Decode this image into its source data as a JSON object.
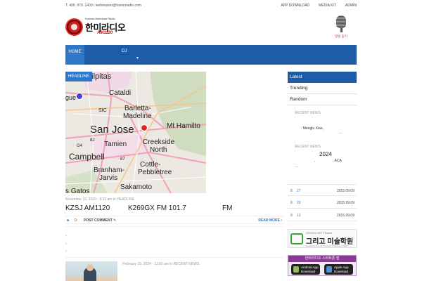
{
  "topbar": {
    "contact": "T: 408. 970. 1400 / webmaster@hanmiradio.com",
    "links": [
      "APP DOWNLOAD",
      "MEDIA KIT",
      "ADMIN"
    ]
  },
  "logo": {
    "tagline": "Korean-American Radio",
    "name": "한미라디오",
    "am": "AM1120"
  },
  "mic": {
    "label": "방송 듣기"
  },
  "nav": {
    "home": "HOME",
    "dj": "DJ",
    "caret": "▼"
  },
  "headline": {
    "badge": "HEADLINE",
    "map_labels": [
      "Milpitas",
      "Cataldi",
      "Barletta-",
      "Madeline",
      "San Jose",
      "Mt Hamilto",
      "Tamien",
      "Creekside",
      "North",
      "Campbell",
      "Branham-",
      "Jarvis",
      "Cottle-",
      "Pebbletree",
      "Sakamoto",
      "s Gatos",
      "gue",
      "SIC",
      "G4",
      "87",
      "82"
    ],
    "meta": "November 10, 2020 - 9:33 am in HEADLINE",
    "title_parts": [
      "KZSJ AM1120",
      "K269GX FM 101.7",
      "FM"
    ],
    "comments": "0",
    "post_comment": "POST COMMENT",
    "read_more": "READ MORE",
    "chevrons": [
      "›",
      "›",
      "›"
    ]
  },
  "second_post": {
    "meta": "February 15, 2024 - 11:03 am in RECENT NEWS"
  },
  "sidebar": {
    "tabs": [
      "Latest",
      "Trending",
      "Random"
    ],
    "recent_label_1": "RECENT NEWS",
    "item1_text_a": ": Menglu Xiao,",
    "item1_text_b": "…",
    "recent_label_2": "RECENT NEWS",
    "item2_year": "2024",
    "item2_text_a": ",",
    "item2_text_b": ", ACA",
    "item2_text_c": "…",
    "rows": [
      {
        "num": "8",
        "n2": "27",
        "date": "2015.09.09"
      },
      {
        "num": "8",
        "n2": "20",
        "date": "2015.09.09"
      },
      {
        "num": "8",
        "n2": "13",
        "date": "2015.09.09"
      }
    ]
  },
  "banner1": {
    "small": "GEUEGO ART STUDIO",
    "big": "그리고 미술학원",
    "sub": "Reaching Your Art Through Creativity & Skills"
  },
  "banner2": {
    "title": "한미라디오 스마트폰 앱",
    "android": [
      "Android App",
      "Download"
    ],
    "apple": [
      "Apple App",
      "Download"
    ]
  },
  "colors": {
    "nav": "#1e5ca8",
    "nav_active": "#2f78c9",
    "accent_red": "#c00000"
  }
}
